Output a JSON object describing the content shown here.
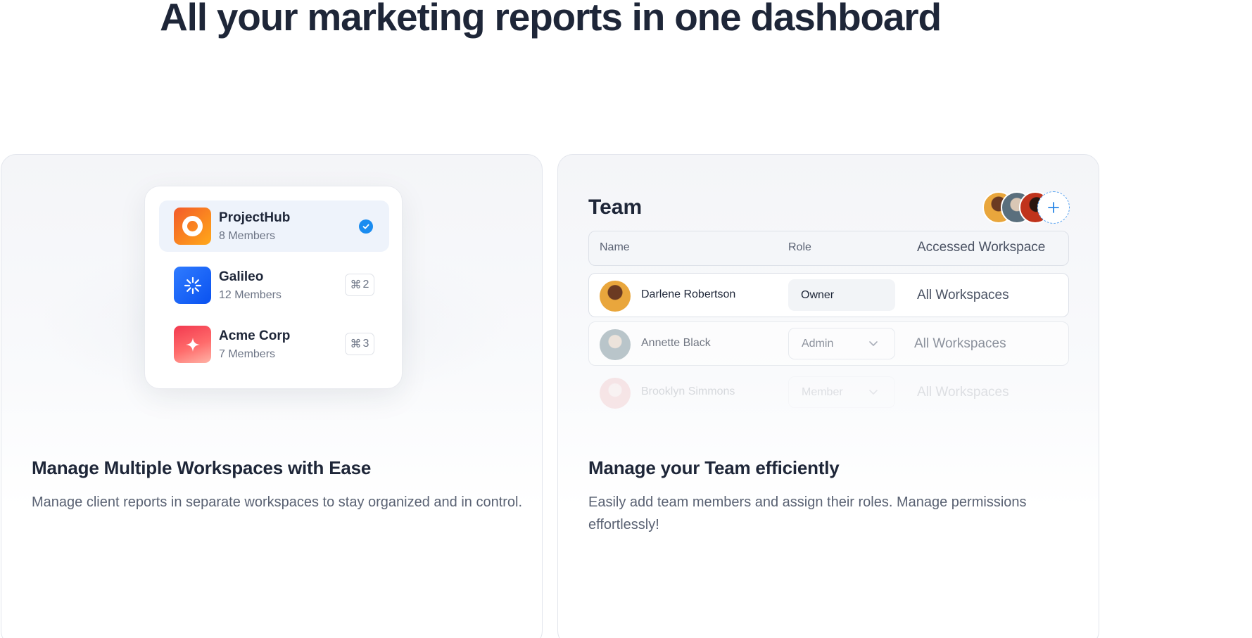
{
  "hero": {
    "title": "All your marketing reports in one dashboard"
  },
  "workspaces_card": {
    "title": "Manage Multiple Workspaces with Ease",
    "description": "Manage client reports in separate workspaces to stay organized and in control.",
    "items": [
      {
        "name": "ProjectHub",
        "members": "8 Members",
        "logo_icon": "ring-logo-icon",
        "color": "#f97316",
        "selected": true
      },
      {
        "name": "Galileo",
        "members": "12 Members",
        "logo_icon": "burst-logo-icon",
        "color": "#1463f5",
        "shortcut_symbol": "⌘",
        "shortcut_key": "2"
      },
      {
        "name": "Acme Corp",
        "members": "7 Members",
        "logo_icon": "sparkle-logo-icon",
        "color": "#f43f5e",
        "shortcut_symbol": "⌘",
        "shortcut_key": "3"
      }
    ]
  },
  "team_card": {
    "panel_title": "Team",
    "add_member_icon": "plus-icon",
    "columns": {
      "name": "Name",
      "role": "Role",
      "workspace": "Accessed Workspace"
    },
    "rows": [
      {
        "name": "Darlene Robertson",
        "role": "Owner",
        "workspace": "All Workspaces"
      },
      {
        "name": "Annette Black",
        "role": "Admin",
        "workspace": "All Workspaces"
      },
      {
        "name": "Brooklyn Simmons",
        "role": "Member",
        "workspace": "All Workspaces"
      }
    ],
    "title": "Manage your Team efficiently",
    "description": "Easily add team members and assign their roles. Manage permissions effortlessly!"
  },
  "colors": {
    "accent": "#1a8cf0",
    "heading": "#1e2638",
    "muted": "#5a6273"
  }
}
